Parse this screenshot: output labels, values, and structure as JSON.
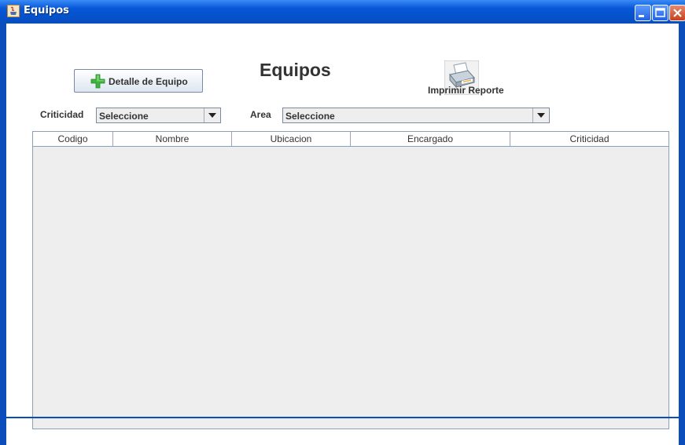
{
  "window": {
    "title": "Equipos",
    "icons": [
      "java-app-icon",
      "minimize-icon",
      "maximize-icon",
      "close-icon"
    ]
  },
  "toolbar": {
    "detail_button_label": "Detalle de Equipo",
    "detail_button_icon": "green-plus-icon",
    "page_title": "Equipos",
    "print_label": "Imprimir Reporte",
    "print_icon": "printer-icon"
  },
  "filters": {
    "criticidad_label": "Criticidad",
    "criticidad_value": "Seleccione",
    "area_label": "Area",
    "area_value": "Seleccione"
  },
  "table": {
    "columns": [
      "Codigo",
      "Nombre",
      "Ubicacion",
      "Encargado",
      "Criticidad"
    ],
    "rows": []
  },
  "colors": {
    "titlebar": "#0757d9",
    "table_background": "#eeeeee",
    "plus_icon": "#3fb33f"
  }
}
